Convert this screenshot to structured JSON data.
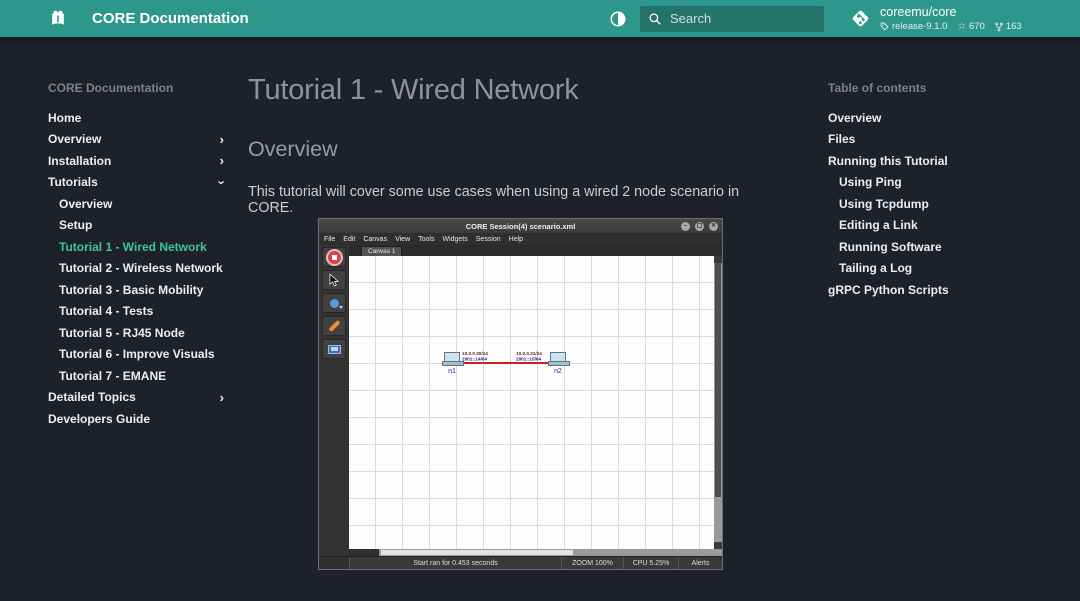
{
  "colors": {
    "primary_teal": "#2e978b",
    "accent_teal": "#3fc2a9",
    "page_background": "#1e2129",
    "link_red": "#cc2020"
  },
  "header": {
    "title": "CORE Documentation",
    "search_placeholder": "Search",
    "repo": {
      "name": "coreemu/core",
      "release": "release-9.1.0",
      "stars": "670",
      "forks": "163"
    }
  },
  "sidebar": {
    "header": "CORE Documentation",
    "items": [
      {
        "label": "Home"
      },
      {
        "label": "Overview",
        "chevron": "right"
      },
      {
        "label": "Installation",
        "chevron": "right"
      },
      {
        "label": "Tutorials",
        "chevron": "down"
      },
      {
        "label": "Overview",
        "sub": true
      },
      {
        "label": "Setup",
        "sub": true
      },
      {
        "label": "Tutorial 1 - Wired Network",
        "sub": true,
        "active": true
      },
      {
        "label": "Tutorial 2 - Wireless Network",
        "sub": true
      },
      {
        "label": "Tutorial 3 - Basic Mobility",
        "sub": true
      },
      {
        "label": "Tutorial 4 - Tests",
        "sub": true
      },
      {
        "label": "Tutorial 5 - RJ45 Node",
        "sub": true
      },
      {
        "label": "Tutorial 6 - Improve Visuals",
        "sub": true
      },
      {
        "label": "Tutorial 7 - EMANE",
        "sub": true
      },
      {
        "label": "Detailed Topics",
        "chevron": "right"
      },
      {
        "label": "Developers Guide"
      }
    ]
  },
  "toc": {
    "header": "Table of contents",
    "items": [
      {
        "label": "Overview"
      },
      {
        "label": "Files"
      },
      {
        "label": "Running this Tutorial"
      },
      {
        "label": "Using Ping",
        "sub": true
      },
      {
        "label": "Using Tcpdump",
        "sub": true
      },
      {
        "label": "Editing a Link",
        "sub": true
      },
      {
        "label": "Running Software",
        "sub": true
      },
      {
        "label": "Tailing a Log",
        "sub": true
      },
      {
        "label": "gRPC Python Scripts"
      }
    ]
  },
  "main": {
    "h1": "Tutorial 1 - Wired Network",
    "h2": "Overview",
    "paragraph": "This tutorial will cover some use cases when using a wired 2 node scenario in CORE."
  },
  "app": {
    "window_title": "CORE Session(4) scenario.xml",
    "window_buttons": {
      "minimize": "–",
      "maximize": "▢",
      "close": "✕"
    },
    "menus": [
      "File",
      "Edit",
      "Canvas",
      "View",
      "Tools",
      "Widgets",
      "Session",
      "Help"
    ],
    "tab": "Canvas 1",
    "nodes": [
      {
        "id": "n1",
        "ip4": "10.0.0.20/24",
        "ip6": "2001::14/64"
      },
      {
        "id": "n2",
        "ip4": "10.0.0.21/24",
        "ip6": "2001::15/64"
      }
    ],
    "statusbar": [
      "Start ran for 0.453 seconds",
      "ZOOM 100%",
      "CPU 5.25%",
      "Alerts"
    ]
  }
}
